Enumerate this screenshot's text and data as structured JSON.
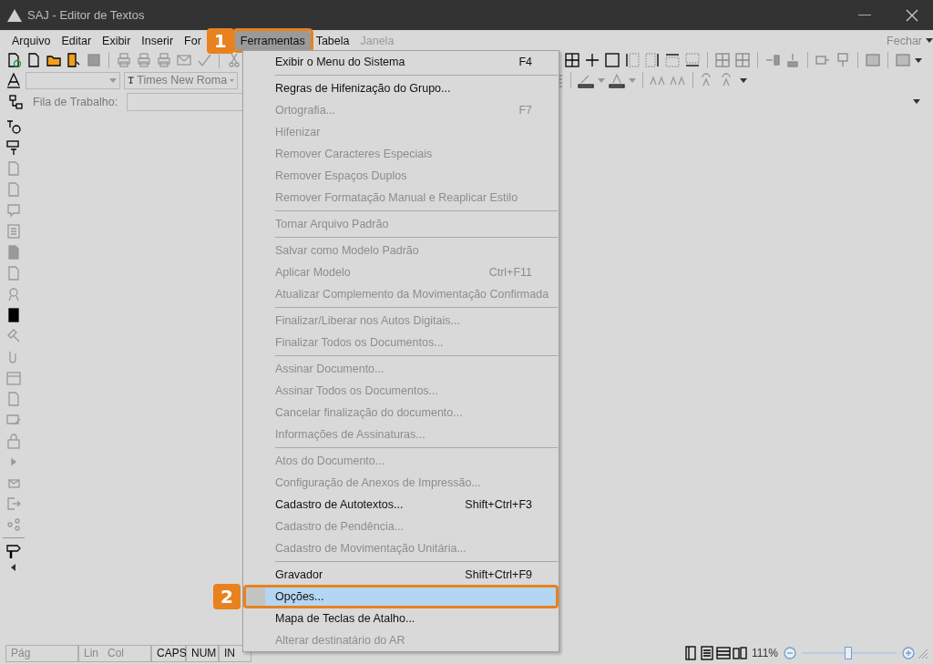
{
  "window": {
    "title": "SAJ - Editor de Textos"
  },
  "menu_bar": {
    "items": [
      {
        "label": "Arquivo",
        "selected": false,
        "disabled": false
      },
      {
        "label": "Editar",
        "selected": false,
        "disabled": false
      },
      {
        "label": "Exibir",
        "selected": false,
        "disabled": false
      },
      {
        "label": "Inserir",
        "selected": false,
        "disabled": false
      },
      {
        "label": "For",
        "selected": false,
        "disabled": false
      },
      {
        "label": "Ferramentas",
        "selected": true,
        "disabled": false,
        "callout": "1"
      },
      {
        "label": "Tabela",
        "selected": false,
        "disabled": false
      },
      {
        "label": "Janela",
        "selected": false,
        "disabled": true
      }
    ],
    "close_label": "Fechar"
  },
  "format_bar": {
    "font_value": "Times New Roma"
  },
  "work_queue": {
    "label": "Fila de Trabalho:"
  },
  "dropdown_menu": {
    "items": [
      {
        "label": "Exibir o Menu do Sistema",
        "shortcut": "F4",
        "disabled": false,
        "selected": false
      },
      {
        "kind": "separator"
      },
      {
        "label": "Regras de Hifenização do Grupo...",
        "disabled": false,
        "selected": false
      },
      {
        "label": "Ortografia...",
        "shortcut": "F7",
        "disabled": true,
        "selected": false
      },
      {
        "label": "Hifenizar",
        "disabled": true,
        "selected": false
      },
      {
        "label": "Remover Caracteres Especiais",
        "disabled": true,
        "selected": false
      },
      {
        "label": "Remover Espaços Duplos",
        "disabled": true,
        "selected": false
      },
      {
        "label": "Remover Formatação Manual e Reaplicar Estilo",
        "disabled": true,
        "selected": false
      },
      {
        "kind": "separator"
      },
      {
        "label": "Tornar Arquivo Padrão",
        "disabled": true,
        "selected": false
      },
      {
        "kind": "separator"
      },
      {
        "label": "Salvar como Modelo Padrão",
        "disabled": true,
        "selected": false
      },
      {
        "label": "Aplicar Modelo",
        "shortcut": "Ctrl+F11",
        "disabled": true,
        "selected": false
      },
      {
        "label": "Atualizar Complemento da Movimentação Confirmada",
        "disabled": true,
        "selected": false
      },
      {
        "kind": "separator"
      },
      {
        "label": "Finalizar/Liberar nos Autos Digitais...",
        "disabled": true,
        "selected": false
      },
      {
        "label": "Finalizar Todos os Documentos...",
        "disabled": true,
        "selected": false
      },
      {
        "kind": "separator"
      },
      {
        "label": "Assinar Documento...",
        "disabled": true,
        "selected": false
      },
      {
        "label": "Assinar Todos os Documentos...",
        "disabled": true,
        "selected": false
      },
      {
        "label": "Cancelar finalização do documento...",
        "disabled": true,
        "selected": false
      },
      {
        "label": "Informações de Assinaturas...",
        "disabled": true,
        "selected": false
      },
      {
        "kind": "separator"
      },
      {
        "label": "Atos do Documento...",
        "disabled": true,
        "selected": false
      },
      {
        "label": "Configuração de Anexos de Impressão...",
        "disabled": true,
        "selected": false
      },
      {
        "label": "Cadastro de Autotextos...",
        "shortcut": "Shift+Ctrl+F3",
        "disabled": false,
        "selected": false
      },
      {
        "label": "Cadastro de Pendência...",
        "disabled": true,
        "selected": false
      },
      {
        "label": "Cadastro de Movimentação Unitária...",
        "disabled": true,
        "selected": false
      },
      {
        "kind": "separator"
      },
      {
        "label": "Gravador",
        "shortcut": "Shift+Ctrl+F9",
        "disabled": false,
        "selected": false
      },
      {
        "label": "Opções...",
        "disabled": false,
        "selected": true,
        "callout": "2"
      },
      {
        "label": "Mapa de Teclas de Atalho...",
        "disabled": false,
        "selected": false
      },
      {
        "label": "Alterar destinatário do AR",
        "disabled": true,
        "selected": false
      }
    ]
  },
  "status_bar": {
    "page": "Pág",
    "line": "Lin",
    "column": "Col",
    "keys": [
      "CAPS",
      "NUM",
      "IN"
    ],
    "zoom": "111%",
    "zoom_slider": {
      "level": 0.49
    }
  }
}
